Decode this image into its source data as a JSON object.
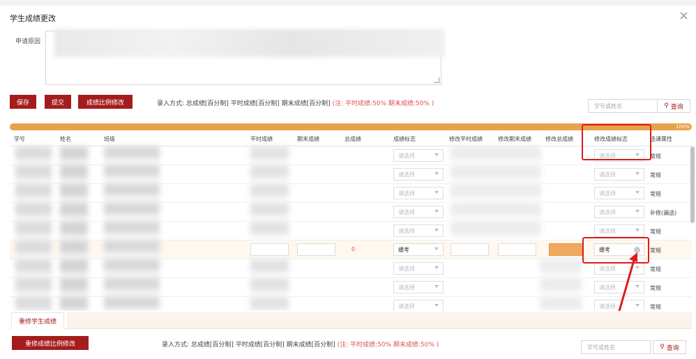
{
  "dialog": {
    "title": "学生成绩更改",
    "close_glyph": "×",
    "reason_label": "申请原因"
  },
  "toolbar": {
    "save_label": "保存",
    "submit_label": "提交",
    "ratio_label": "成绩比例修改",
    "entry_mode": "录入方式: 总成绩[百分制]  平时成绩[百分制]  期末成绩[百分制]",
    "ratio_note": "(注: 平时成绩:50% 期末成绩:50% )",
    "search_placeholder": "学号或姓名",
    "search_label": "查询"
  },
  "progress": {
    "percent": 100,
    "label": "100%"
  },
  "table": {
    "headers": [
      "学号",
      "姓名",
      "班级",
      "平时成绩",
      "期末成绩",
      "总成绩",
      "成绩标志",
      "修改平时成绩",
      "修改期末成绩",
      "修改总成绩",
      "修改成绩标志",
      "选课属性"
    ],
    "rows": [
      {
        "flag": "请选择",
        "mod_flag": "请选择",
        "attr": "常规"
      },
      {
        "flag": "请选择",
        "mod_flag": "请选择",
        "attr": "常规"
      },
      {
        "flag": "请选择",
        "mod_flag": "请选择",
        "attr": "常规"
      },
      {
        "flag": "请选择",
        "mod_flag": "请选择",
        "attr": "补修(漏选)"
      },
      {
        "flag": "请选择",
        "mod_flag": "请选择",
        "attr": "常规"
      },
      {
        "flag": "缓考",
        "mod_flag": "缓考",
        "attr": "常规",
        "total": "0"
      },
      {
        "flag": "请选择",
        "mod_flag": "请选择",
        "attr": "常规"
      },
      {
        "flag": "请选择",
        "mod_flag": "请选择",
        "attr": "常规"
      },
      {
        "flag": "请选择",
        "mod_flag": "请选择",
        "attr": "常规"
      }
    ]
  },
  "bottom": {
    "tab_label": "重修学生成绩",
    "ratio_label": "重修成绩比例修改",
    "entry_mode": "录入方式: 总成绩[百分制]  平时成绩[百分制]  期末成绩[百分制]",
    "ratio_note": "(注: 平时成绩:50% 期末成绩:50% )",
    "search_placeholder": "学号或姓名",
    "search_label": "查询"
  },
  "colors": {
    "brand": "#a51c1c",
    "progress": "#e8a24a",
    "annotation": "#e01b1b"
  }
}
